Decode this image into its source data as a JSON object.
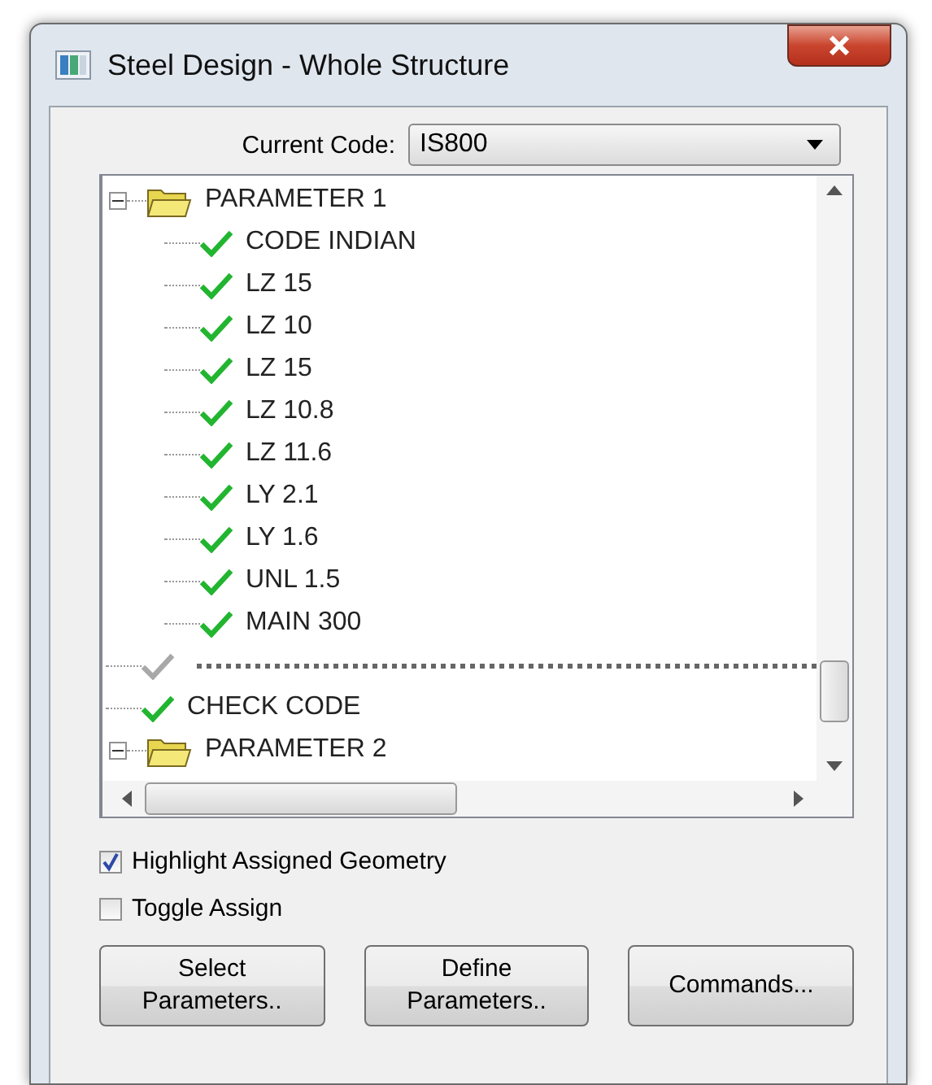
{
  "window": {
    "title": "Steel Design - Whole Structure"
  },
  "current_code": {
    "label": "Current Code:",
    "value": "IS800"
  },
  "tree": [
    {
      "kind": "folder",
      "label": "PARAMETER 1",
      "expanded": true,
      "children": [
        {
          "kind": "item",
          "label": "CODE INDIAN",
          "active": true
        },
        {
          "kind": "item",
          "label": "LZ 15",
          "active": true
        },
        {
          "kind": "item",
          "label": "LZ 10",
          "active": true
        },
        {
          "kind": "item",
          "label": "LZ 15",
          "active": true
        },
        {
          "kind": "item",
          "label": "LZ 10.8",
          "active": true
        },
        {
          "kind": "item",
          "label": "LZ 11.6",
          "active": true
        },
        {
          "kind": "item",
          "label": "LY 2.1",
          "active": true
        },
        {
          "kind": "item",
          "label": "LY 1.6",
          "active": true
        },
        {
          "kind": "item",
          "label": "UNL 1.5",
          "active": true
        },
        {
          "kind": "item",
          "label": "MAIN 300",
          "active": true
        }
      ]
    },
    {
      "kind": "separator",
      "active": false
    },
    {
      "kind": "item",
      "label": "CHECK CODE",
      "active": true
    },
    {
      "kind": "folder",
      "label": "PARAMETER 2",
      "expanded": true
    }
  ],
  "checkboxes": [
    {
      "label": "Highlight Assigned Geometry",
      "checked": true
    },
    {
      "label": "Toggle Assign",
      "checked": false
    }
  ],
  "buttons": [
    "Select\nParameters..",
    "Define\nParameters..",
    "Commands..."
  ]
}
